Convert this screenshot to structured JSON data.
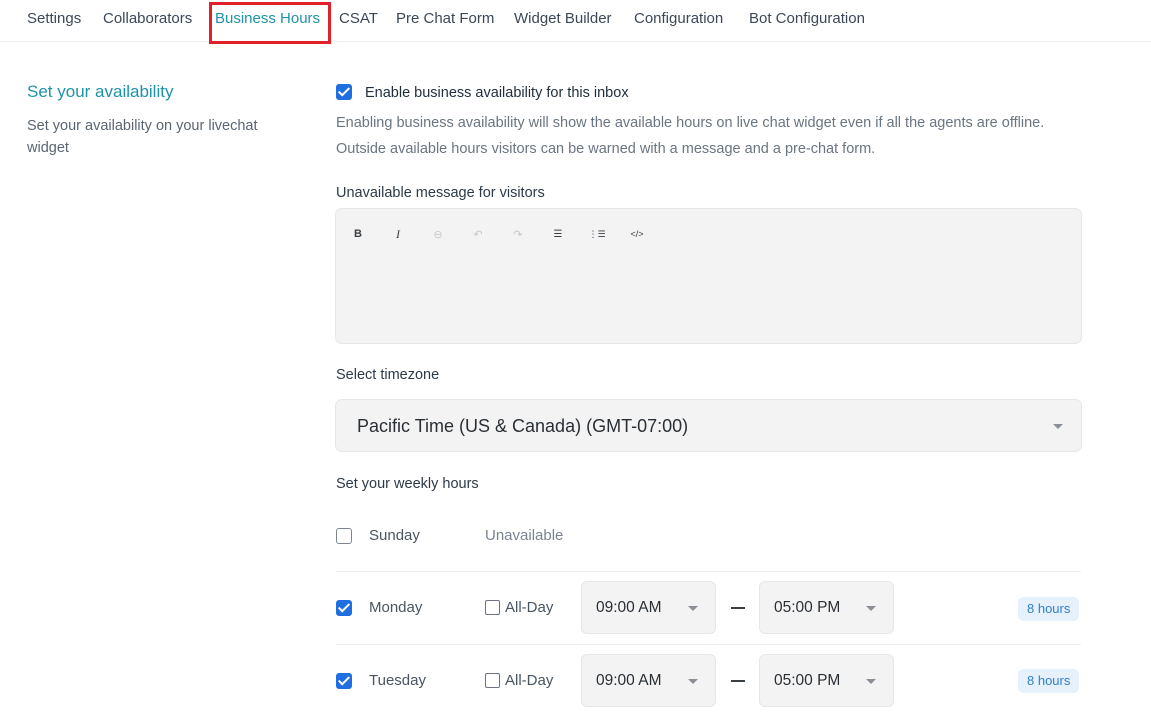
{
  "tabs": [
    {
      "label": "Settings"
    },
    {
      "label": "Collaborators"
    },
    {
      "label": "Business Hours"
    },
    {
      "label": "CSAT"
    },
    {
      "label": "Pre Chat Form"
    },
    {
      "label": "Widget Builder"
    },
    {
      "label": "Configuration"
    },
    {
      "label": "Bot Configuration"
    }
  ],
  "active_tab": "Business Hours",
  "availability": {
    "title": "Set your availability",
    "description": "Set your availability on your livechat widget"
  },
  "enable": {
    "checked": true,
    "label": "Enable business availability for this inbox",
    "help": "Enabling business availability will show the available hours on live chat widget even if all the agents are offline. Outside available hours visitors can be warned with a message and a pre-chat form."
  },
  "unavailable_message": {
    "label": "Unavailable message for visitors",
    "toolbar": [
      "bold-icon",
      "italic-icon",
      "link-icon",
      "undo-icon",
      "redo-icon",
      "bullet-list-icon",
      "numbered-list-icon",
      "code-icon"
    ],
    "toolbar_glyphs": [
      "B",
      "I",
      "⊖",
      "↶",
      "↷",
      "☰",
      "⋮☰",
      "</>"
    ]
  },
  "timezone": {
    "label": "Select timezone",
    "value": "Pacific Time (US & Canada) (GMT-07:00)"
  },
  "weekly": {
    "label": "Set your weekly hours",
    "days": [
      {
        "name": "Sunday",
        "enabled": false,
        "status": "Unavailable"
      },
      {
        "name": "Monday",
        "enabled": true,
        "all_day_label": "All-Day",
        "all_day": false,
        "from": "09:00 AM",
        "to": "05:00 PM",
        "hours": "8 hours"
      },
      {
        "name": "Tuesday",
        "enabled": true,
        "all_day_label": "All-Day",
        "all_day": false,
        "from": "09:00 AM",
        "to": "05:00 PM",
        "hours": "8 hours"
      }
    ]
  },
  "colors": {
    "accent": "#1f93a8",
    "checkbox": "#1f6fe0",
    "highlight": "#e0202a",
    "badge_bg": "#e6f1fc",
    "badge_text": "#2f7fd0"
  }
}
